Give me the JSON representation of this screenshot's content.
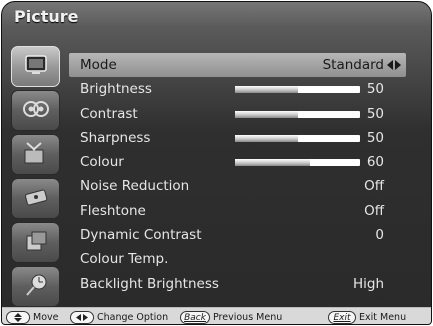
{
  "menu_title": "Picture",
  "sidebar": {
    "items": [
      {
        "icon": "picture-icon",
        "active": true
      },
      {
        "icon": "sound-icon",
        "active": false
      },
      {
        "icon": "channel-icon",
        "active": false
      },
      {
        "icon": "feature-icon",
        "active": false
      },
      {
        "icon": "setup-icon",
        "active": false
      },
      {
        "icon": "timer-icon",
        "active": false
      }
    ]
  },
  "rows": [
    {
      "label": "Mode",
      "value": "Standard",
      "selected": true
    },
    {
      "label": "Brightness",
      "value": "50",
      "level": 0.5
    },
    {
      "label": "Contrast",
      "value": "50",
      "level": 0.5
    },
    {
      "label": "Sharpness",
      "value": "50",
      "level": 0.5
    },
    {
      "label": "Colour",
      "value": "60",
      "level": 0.6
    },
    {
      "label": "Noise Reduction",
      "value": "Off"
    },
    {
      "label": "Fleshtone",
      "value": "Off"
    },
    {
      "label": "Dynamic Contrast",
      "value": "0"
    },
    {
      "label": "Colour Temp.",
      "value": ""
    },
    {
      "label": "Backlight Brightness",
      "value": "High"
    }
  ],
  "footer": {
    "move": "Move",
    "change_option": "Change Option",
    "back_key": "Back",
    "previous_menu": "Previous Menu",
    "exit_key": "Exit",
    "exit_menu": "Exit Menu"
  }
}
